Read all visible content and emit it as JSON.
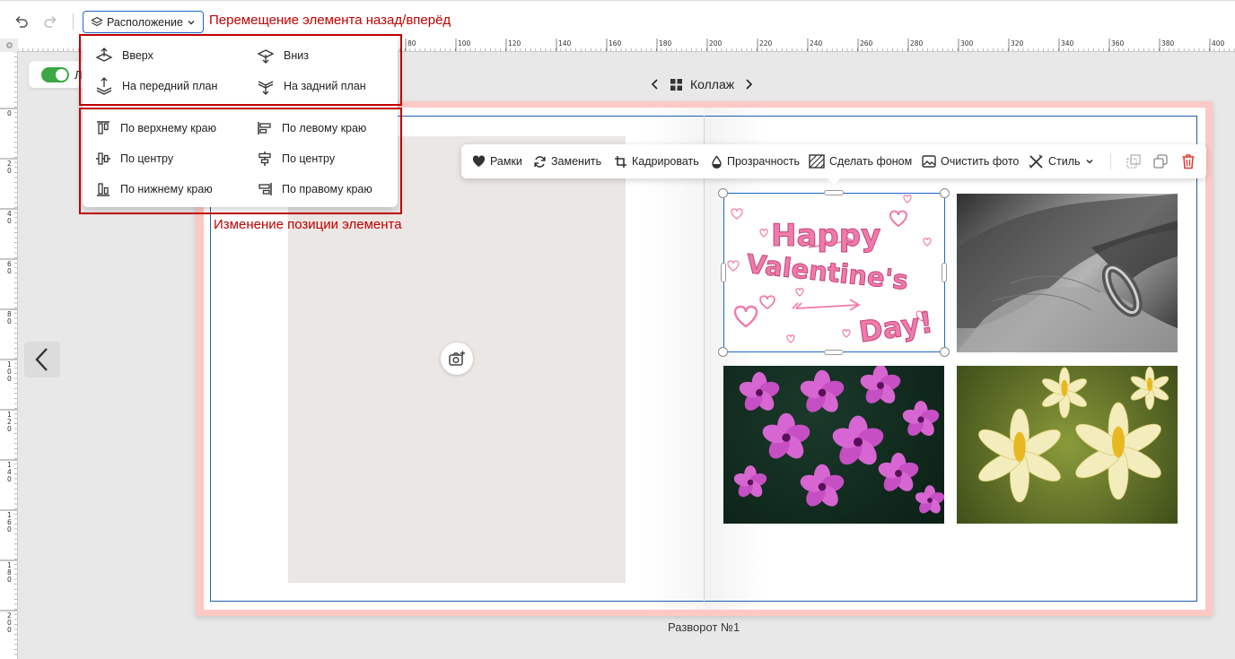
{
  "toolbar": {
    "undo_icon": "undo-icon",
    "redo_icon": "redo-icon",
    "arrange_label": "Расположение"
  },
  "annotations": {
    "move_note": "Перемещение элемента назад/вперёд",
    "position_note": "Изменение позиции элемента"
  },
  "arrange_menu": {
    "order": [
      {
        "label": "Вверх",
        "icon": "layer-up-icon"
      },
      {
        "label": "Вниз",
        "icon": "layer-down-icon"
      },
      {
        "label": "На передний план",
        "icon": "bring-front-icon"
      },
      {
        "label": "На задний план",
        "icon": "send-back-icon"
      }
    ],
    "align": [
      {
        "label": "По верхнему краю",
        "icon": "align-top-icon"
      },
      {
        "label": "По левому краю",
        "icon": "align-left-icon"
      },
      {
        "label": "По центру",
        "icon": "align-vcenter-icon"
      },
      {
        "label": "По центру",
        "icon": "align-hcenter-icon"
      },
      {
        "label": "По нижнему краю",
        "icon": "align-bottom-icon"
      },
      {
        "label": "По правому краю",
        "icon": "align-right-icon"
      }
    ]
  },
  "ruler": {
    "top_labels": [
      "80",
      "100",
      "120",
      "140",
      "160",
      "180",
      "200",
      "220",
      "240",
      "260",
      "280",
      "300",
      "320",
      "340",
      "360",
      "380",
      "400"
    ],
    "left_labels": [
      "0",
      "20",
      "40",
      "60",
      "80",
      "100",
      "120",
      "140",
      "160",
      "180",
      "200"
    ]
  },
  "toggle": {
    "label_fragment": "Л",
    "on": true
  },
  "spread_nav": {
    "label": "Коллаж",
    "icon": "grid-icon"
  },
  "element_toolbar": {
    "frames": "Рамки",
    "replace": "Заменить",
    "crop": "Кадрировать",
    "opacity": "Прозрачность",
    "background": "Сделать фоном",
    "clean": "Очистить фото",
    "style": "Стиль"
  },
  "valentine": {
    "line1": "Happy",
    "line2": "Valentine's",
    "line3": "Day!"
  },
  "caption": "Разворот №1",
  "colors": {
    "accent": "#1b6ad1",
    "annotation_red": "#c00000",
    "spread_border": "#fcc9c5",
    "toggle_green": "#3aa844",
    "valentine_pink": "#f07aaa"
  }
}
